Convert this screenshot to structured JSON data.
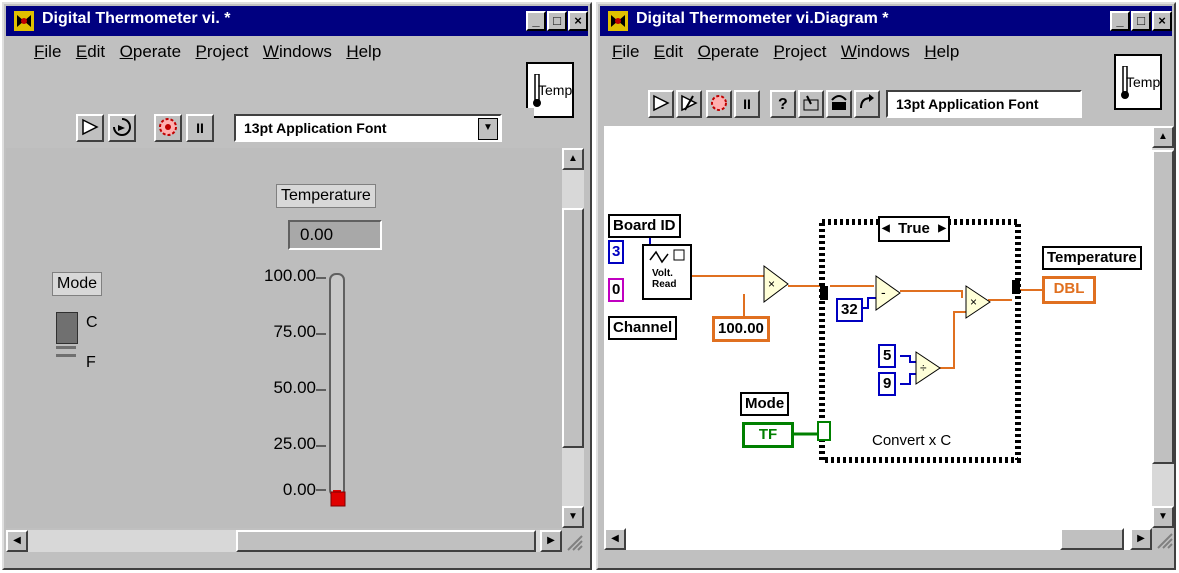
{
  "colors": {
    "titlebar": "#000080",
    "window_face": "#c0c0c0",
    "wire_numeric": "#e07020",
    "wire_integer": "#0000c0",
    "wire_boolean": "#008000",
    "wire_cluster": "#c000c0",
    "led_red": "#e00000"
  },
  "front_panel": {
    "title": "Digital Thermometer vi. *",
    "window_buttons": [
      "_",
      "□",
      "×"
    ],
    "menus": [
      "File",
      "Edit",
      "Operate",
      "Project",
      "Windows",
      "Help"
    ],
    "toolbar_icons": [
      "run-arrow-icon",
      "run-continuously-icon",
      "abort-icon",
      "pause-icon"
    ],
    "pause_label": "II",
    "font_select": "13pt Application Font",
    "vi_icon_label": "Temp",
    "temperature_label": "Temperature",
    "temperature_value": "0.00",
    "mode_label": "Mode",
    "mode_options": [
      "C",
      "F"
    ],
    "mode_value": "C",
    "thermometer_level": 0,
    "scale_ticks": [
      "100.00",
      "75.00",
      "50.00",
      "25.00",
      "0.00"
    ]
  },
  "block_diagram": {
    "title": "Digital Thermometer vi.Diagram *",
    "window_buttons": [
      "_",
      "□",
      "×"
    ],
    "menus": [
      "File",
      "Edit",
      "Operate",
      "Project",
      "Windows",
      "Help"
    ],
    "toolbar_icons": [
      "run-arrow-icon",
      "broken-run-icon",
      "abort-icon",
      "pause-icon",
      "help-icon",
      "step-into-icon",
      "step-over-icon",
      "step-out-icon"
    ],
    "pause_label": "II",
    "font_select": "13pt Application Font",
    "vi_icon_label": "Temp",
    "board_id_label": "Board ID",
    "board_id_value": "3",
    "channel_value": "0",
    "channel_label": "Channel",
    "volt_read_label": "Volt. Read",
    "scale_constant": "100.00",
    "case_selector": "True",
    "offset_constant": "32",
    "ratio_numerator": "5",
    "ratio_denominator": "9",
    "case_caption": "Convert x  C",
    "mode_label": "Mode",
    "mode_terminal": "TF",
    "temperature_label": "Temperature",
    "temperature_terminal": "DBL"
  }
}
